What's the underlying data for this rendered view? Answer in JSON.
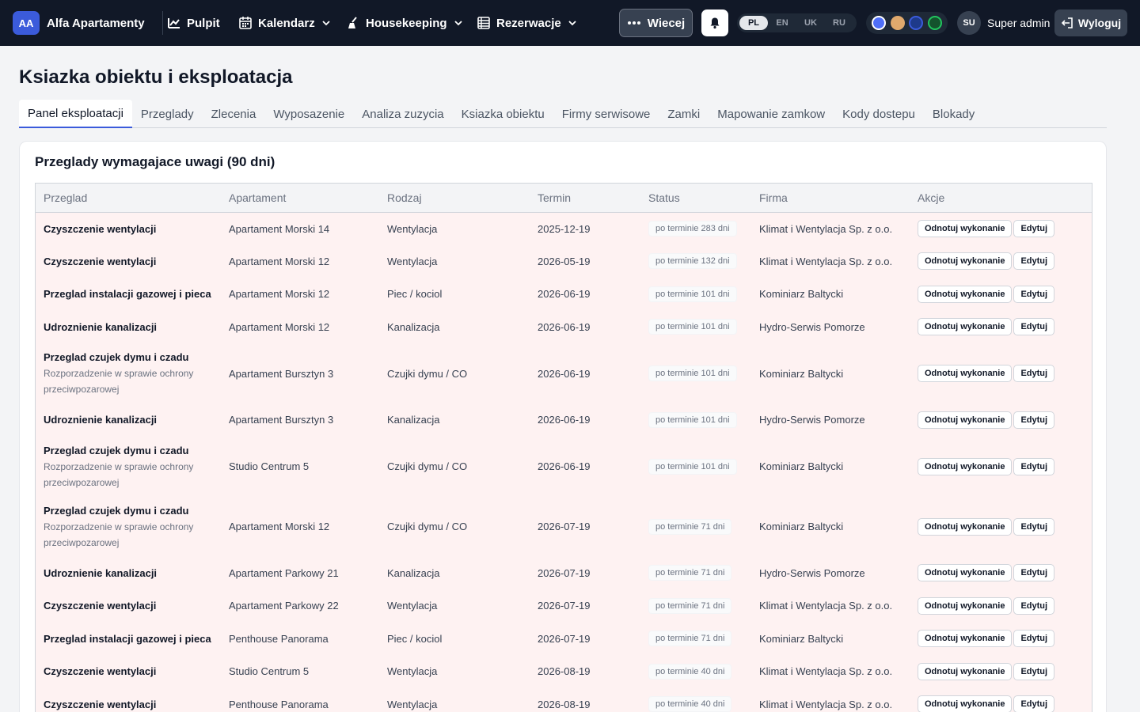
{
  "brand": {
    "initials": "AA",
    "name": "Alfa Apartamenty"
  },
  "nav": {
    "items": [
      {
        "label": "Pulpit",
        "icon": "chart-icon"
      },
      {
        "label": "Kalendarz",
        "icon": "calendar-icon"
      },
      {
        "label": "Housekeeping",
        "icon": "broom-icon"
      },
      {
        "label": "Rezerwacje",
        "icon": "list-icon"
      }
    ],
    "more_label": "Wiecej",
    "languages": [
      "PL",
      "EN",
      "UK",
      "RU"
    ],
    "active_language": "PL",
    "theme_colors": [
      "#4f6ef7",
      "#e0a96d",
      "#1e3a8a",
      "#14532d"
    ],
    "user_initials": "SU",
    "user_name": "Super admin",
    "logout_label": "Wyloguj"
  },
  "page": {
    "title": "Ksiazka obiektu i eksploatacja",
    "tabs": [
      "Panel eksploatacji",
      "Przeglady",
      "Zlecenia",
      "Wyposazenie",
      "Analiza zuzycia",
      "Ksiazka obiektu",
      "Firmy serwisowe",
      "Zamki",
      "Mapowanie zamkow",
      "Kody dostepu",
      "Blokady"
    ],
    "active_tab": "Panel eksploatacji"
  },
  "card": {
    "title": "Przeglady wymagajace uwagi (90 dni)",
    "columns": [
      "Przeglad",
      "Apartament",
      "Rodzaj",
      "Termin",
      "Status",
      "Firma",
      "Akcje"
    ],
    "actions": {
      "complete": "Odnotuj wykonanie",
      "edit": "Edytuj"
    },
    "rows": [
      {
        "name": "Czyszczenie wentylacji",
        "note": "",
        "apartment": "Apartament Morski 14",
        "type": "Wentylacja",
        "date": "2025-12-19",
        "status": "po terminie 283 dni",
        "company": "Klimat i Wentylacja Sp. z o.o."
      },
      {
        "name": "Czyszczenie wentylacji",
        "note": "",
        "apartment": "Apartament Morski 12",
        "type": "Wentylacja",
        "date": "2026-05-19",
        "status": "po terminie 132 dni",
        "company": "Klimat i Wentylacja Sp. z o.o."
      },
      {
        "name": "Przeglad instalacji gazowej i pieca",
        "note": "",
        "apartment": "Apartament Morski 12",
        "type": "Piec / kociol",
        "date": "2026-06-19",
        "status": "po terminie 101 dni",
        "company": "Kominiarz Baltycki"
      },
      {
        "name": "Udroznienie kanalizacji",
        "note": "",
        "apartment": "Apartament Morski 12",
        "type": "Kanalizacja",
        "date": "2026-06-19",
        "status": "po terminie 101 dni",
        "company": "Hydro-Serwis Pomorze"
      },
      {
        "name": "Przeglad czujek dymu i czadu",
        "note": "Rozporzadzenie w sprawie ochrony przeciwpozarowej",
        "apartment": "Apartament Bursztyn 3",
        "type": "Czujki dymu / CO",
        "date": "2026-06-19",
        "status": "po terminie 101 dni",
        "company": "Kominiarz Baltycki"
      },
      {
        "name": "Udroznienie kanalizacji",
        "note": "",
        "apartment": "Apartament Bursztyn 3",
        "type": "Kanalizacja",
        "date": "2026-06-19",
        "status": "po terminie 101 dni",
        "company": "Hydro-Serwis Pomorze"
      },
      {
        "name": "Przeglad czujek dymu i czadu",
        "note": "Rozporzadzenie w sprawie ochrony przeciwpozarowej",
        "apartment": "Studio Centrum 5",
        "type": "Czujki dymu / CO",
        "date": "2026-06-19",
        "status": "po terminie 101 dni",
        "company": "Kominiarz Baltycki"
      },
      {
        "name": "Przeglad czujek dymu i czadu",
        "note": "Rozporzadzenie w sprawie ochrony przeciwpozarowej",
        "apartment": "Apartament Morski 12",
        "type": "Czujki dymu / CO",
        "date": "2026-07-19",
        "status": "po terminie 71 dni",
        "company": "Kominiarz Baltycki"
      },
      {
        "name": "Udroznienie kanalizacji",
        "note": "",
        "apartment": "Apartament Parkowy 21",
        "type": "Kanalizacja",
        "date": "2026-07-19",
        "status": "po terminie 71 dni",
        "company": "Hydro-Serwis Pomorze"
      },
      {
        "name": "Czyszczenie wentylacji",
        "note": "",
        "apartment": "Apartament Parkowy 22",
        "type": "Wentylacja",
        "date": "2026-07-19",
        "status": "po terminie 71 dni",
        "company": "Klimat i Wentylacja Sp. z o.o."
      },
      {
        "name": "Przeglad instalacji gazowej i pieca",
        "note": "",
        "apartment": "Penthouse Panorama",
        "type": "Piec / kociol",
        "date": "2026-07-19",
        "status": "po terminie 71 dni",
        "company": "Kominiarz Baltycki"
      },
      {
        "name": "Czyszczenie wentylacji",
        "note": "",
        "apartment": "Studio Centrum 5",
        "type": "Wentylacja",
        "date": "2026-08-19",
        "status": "po terminie 40 dni",
        "company": "Klimat i Wentylacja Sp. z o.o."
      },
      {
        "name": "Czyszczenie wentylacji",
        "note": "",
        "apartment": "Penthouse Panorama",
        "type": "Wentylacja",
        "date": "2026-08-19",
        "status": "po terminie 40 dni",
        "company": "Klimat i Wentylacja Sp. z o.o."
      }
    ]
  }
}
